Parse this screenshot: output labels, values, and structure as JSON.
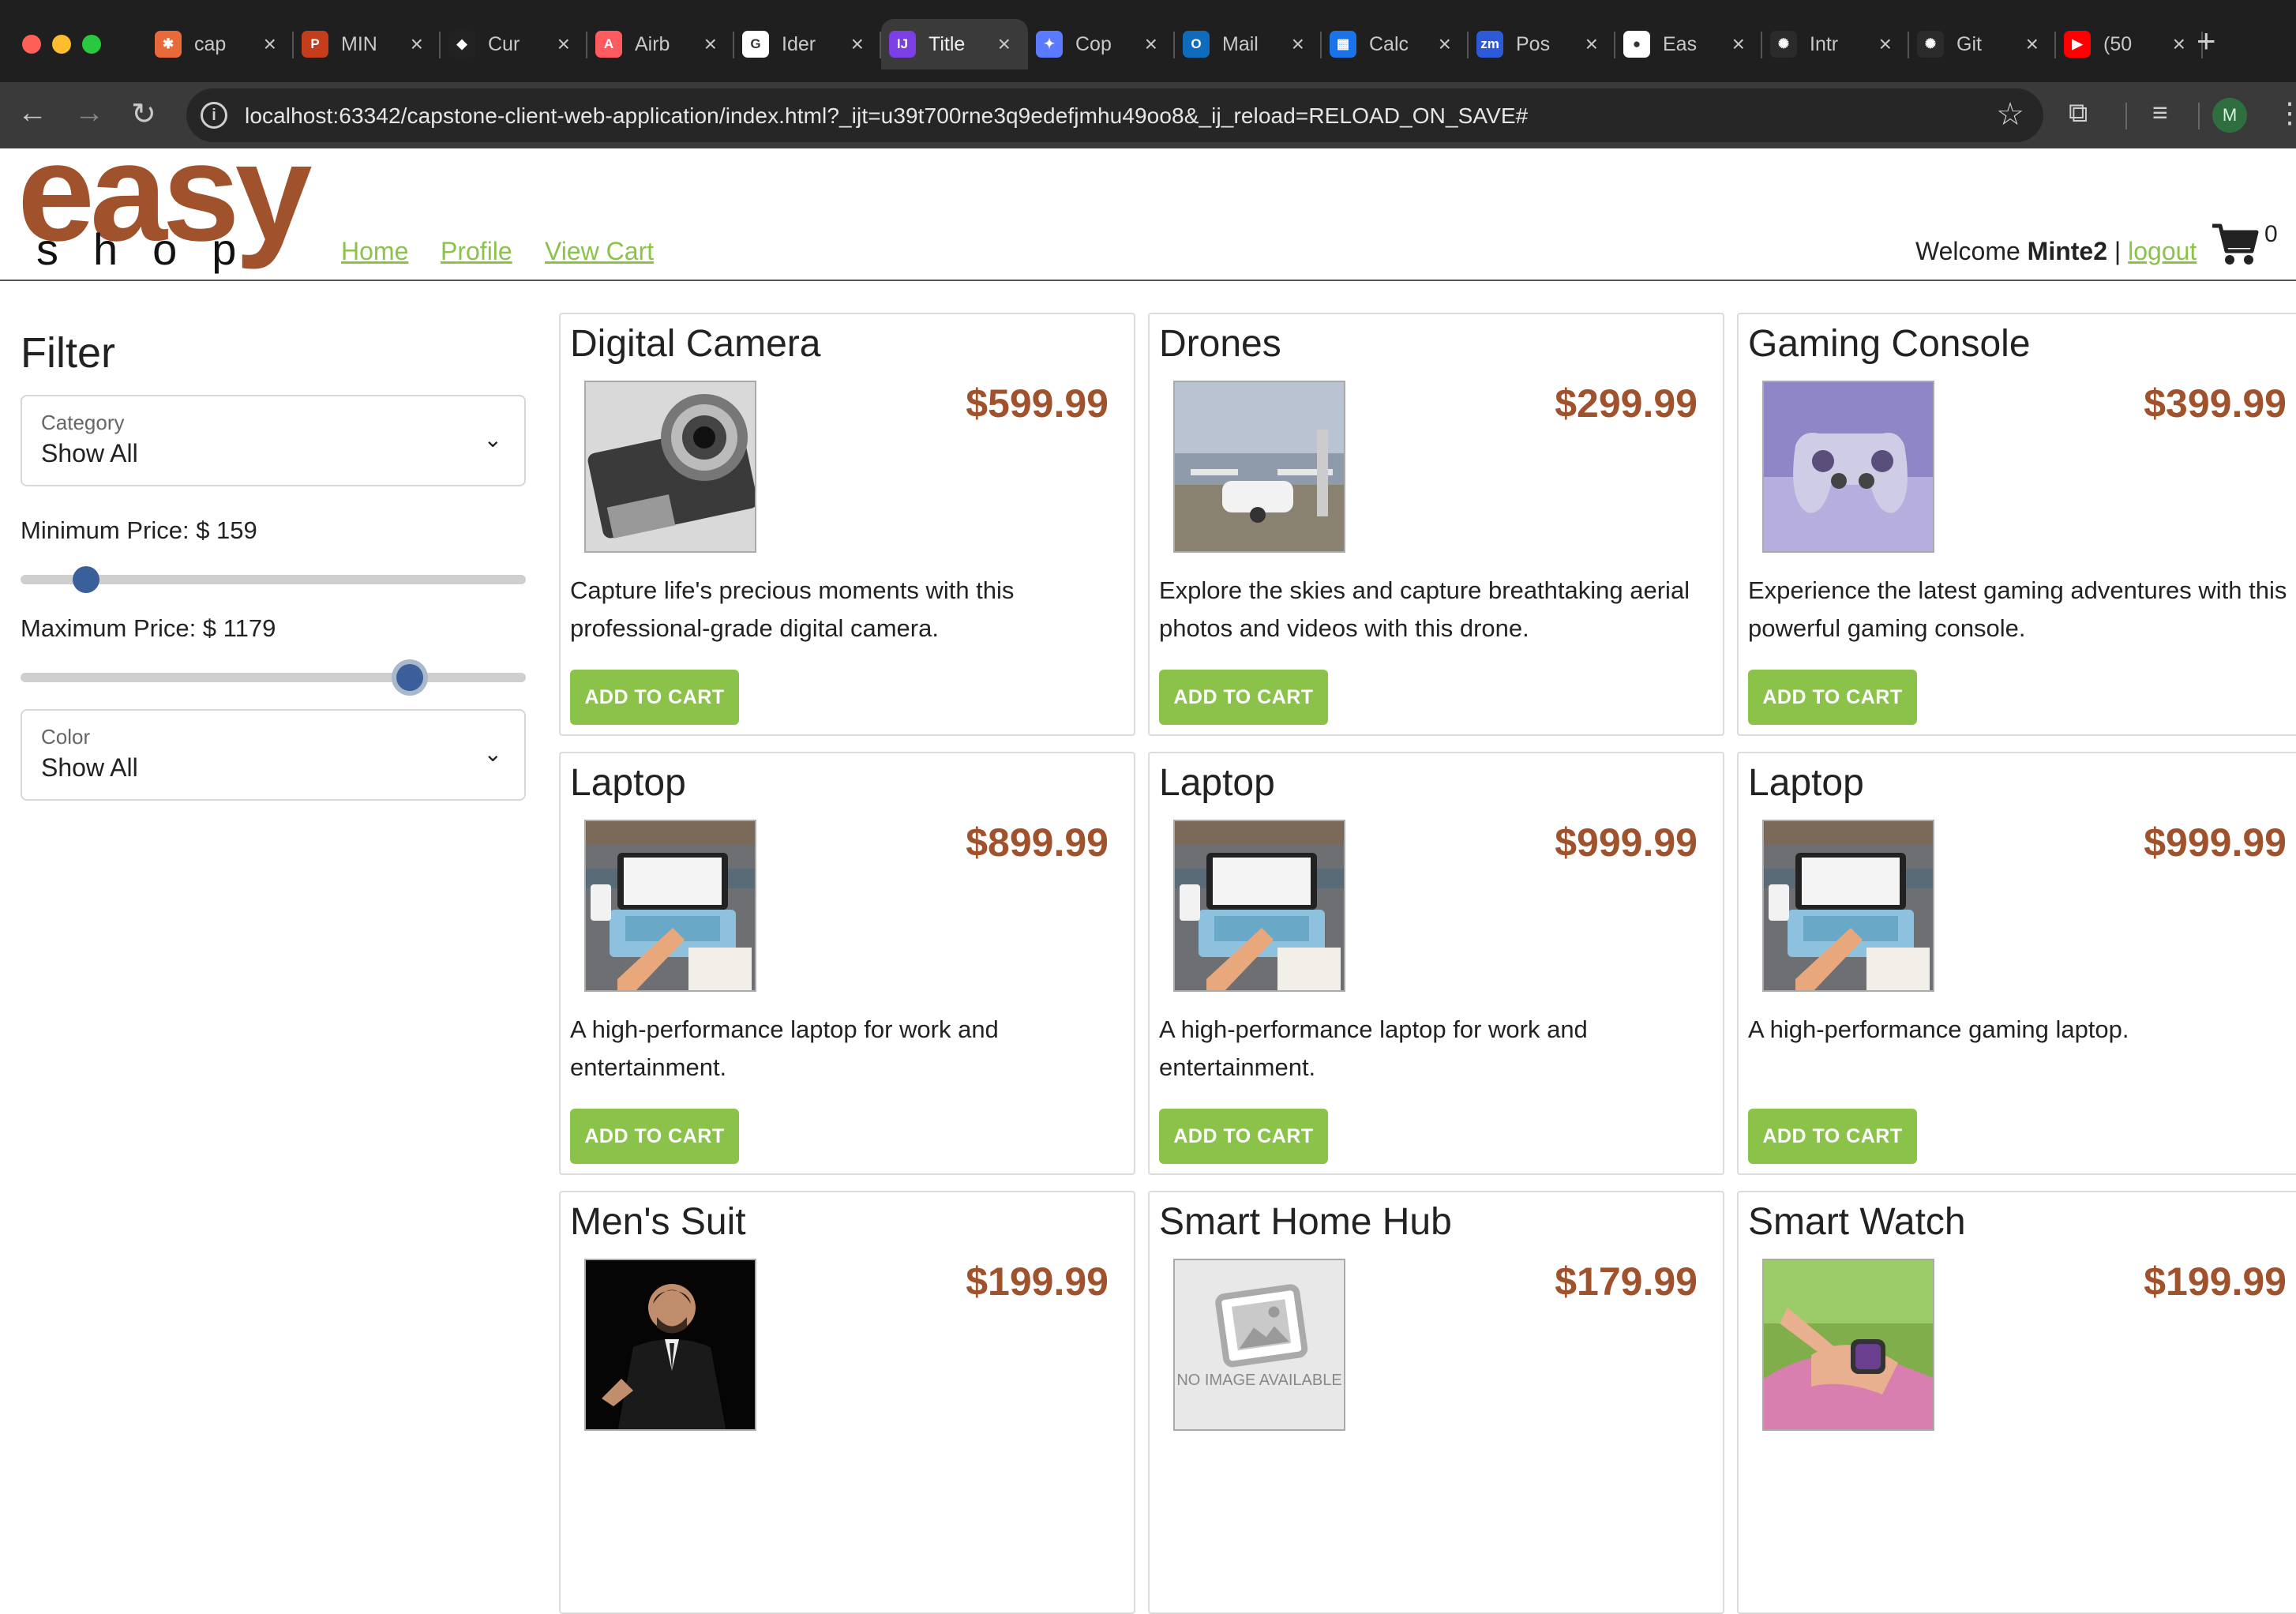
{
  "browser": {
    "tabs": [
      {
        "title": "cap",
        "icon": "claude-icon",
        "fav_color": "#e8693a",
        "fav_text": "✱"
      },
      {
        "title": "MIN",
        "icon": "powerpoint-icon",
        "fav_color": "#c43e1c",
        "fav_text": "P"
      },
      {
        "title": "Cur",
        "icon": "cursor-icon",
        "fav_color": "#222222",
        "fav_text": "◆"
      },
      {
        "title": "Airb",
        "icon": "airbnb-icon",
        "fav_color": "#ff5a5f",
        "fav_text": "A"
      },
      {
        "title": "Ider",
        "icon": "google-icon",
        "fav_color": "#ffffff",
        "fav_text": "G"
      },
      {
        "title": "Title",
        "icon": "jetbrains-icon",
        "fav_color": "#7b3fe4",
        "fav_text": "IJ"
      },
      {
        "title": "Cop",
        "icon": "copilot-icon",
        "fav_color": "#5a7bff",
        "fav_text": "✦"
      },
      {
        "title": "Mail",
        "icon": "outlook-icon",
        "fav_color": "#0f6cbd",
        "fav_text": "O"
      },
      {
        "title": "Calc",
        "icon": "calendar-icon",
        "fav_color": "#1a73e8",
        "fav_text": "▦"
      },
      {
        "title": "Pos",
        "icon": "zoom-icon",
        "fav_color": "#2d5bd8",
        "fav_text": "zm"
      },
      {
        "title": "Eas",
        "icon": "github-icon",
        "fav_color": "#ffffff",
        "fav_text": "●"
      },
      {
        "title": "Intr",
        "icon": "openai-icon",
        "fav_color": "#2b2b2b",
        "fav_text": "✺"
      },
      {
        "title": "Git",
        "icon": "chatgpt-icon",
        "fav_color": "#2b2b2b",
        "fav_text": "✺"
      },
      {
        "title": "(50",
        "icon": "youtube-icon",
        "fav_color": "#ff0000",
        "fav_text": "▶"
      }
    ],
    "active_tab": 5,
    "url": "localhost:63342/capstone-client-web-application/index.html?_ijt=u39t700rne3q9edefjmhu49oo8&_ij_reload=RELOAD_ON_SAVE#",
    "profile_initial": "M"
  },
  "site": {
    "logo_top": "easy",
    "logo_bottom": "shop",
    "nav": [
      "Home",
      "Profile",
      "View Cart"
    ],
    "welcome_prefix": "Welcome ",
    "username": "Minte2",
    "separator": " | ",
    "logout": "logout",
    "cart_count": "0"
  },
  "filter": {
    "title": "Filter",
    "category_label": "Category",
    "category_value": "Show All",
    "min_price_label": "Minimum Price: $ 159",
    "min_fraction": 0.13,
    "max_price_label": "Maximum Price: $ 1179",
    "max_fraction": 0.77,
    "color_label": "Color",
    "color_value": "Show All"
  },
  "products": [
    {
      "name": "Digital Camera",
      "price": "$599.99",
      "description": "Capture life's precious moments with this professional-grade digital camera.",
      "button": "ADD TO CART",
      "image": "camera"
    },
    {
      "name": "Drones",
      "price": "$299.99",
      "description": "Explore the skies and capture breathtaking aerial photos and videos with this drone.",
      "button": "ADD TO CART",
      "image": "drone"
    },
    {
      "name": "Gaming Console",
      "price": "$399.99",
      "description": "Experience the latest gaming adventures with this powerful gaming console.",
      "button": "ADD TO CART",
      "image": "gamepad"
    },
    {
      "name": "Laptop",
      "price": "$899.99",
      "description": "A high-performance laptop for work and entertainment.",
      "button": "ADD TO CART",
      "image": "laptop"
    },
    {
      "name": "Laptop",
      "price": "$999.99",
      "description": "A high-performance laptop for work and entertainment.",
      "button": "ADD TO CART",
      "image": "laptop"
    },
    {
      "name": "Laptop",
      "price": "$999.99",
      "description": "A high-performance gaming laptop.",
      "button": "ADD TO CART",
      "image": "laptop"
    },
    {
      "name": "Men's Suit",
      "price": "$199.99",
      "description": "",
      "button": "",
      "image": "suit"
    },
    {
      "name": "Smart Home Hub",
      "price": "$179.99",
      "description": "",
      "button": "",
      "image": "noimage",
      "image_text": "NO IMAGE AVAILABLE"
    },
    {
      "name": "Smart Watch",
      "price": "$199.99",
      "description": "",
      "button": "",
      "image": "watch"
    }
  ]
}
